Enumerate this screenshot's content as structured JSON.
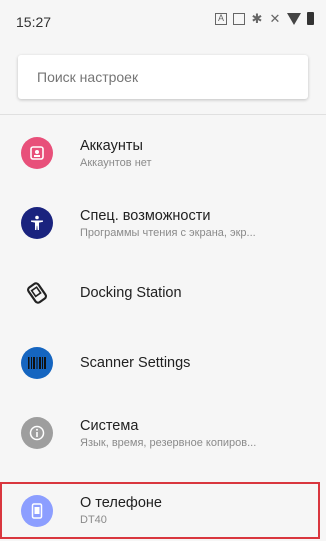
{
  "status_bar": {
    "time": "15:27",
    "icons": [
      "accessibility-a-icon",
      "screenshot-icon",
      "bluetooth-icon",
      "mute-icon",
      "wifi-icon",
      "battery-icon"
    ]
  },
  "search": {
    "placeholder": "Поиск настроек"
  },
  "colors": {
    "accounts": "#e8507a",
    "accessibility": "#1a237e",
    "scanner": "#1565c0",
    "system": "#9e9e9e",
    "about": "#8c9eff",
    "highlight": "#d9363e"
  },
  "settings": {
    "items": [
      {
        "icon": "account-icon",
        "title": "Аккаунты",
        "subtitle": "Аккаунтов нет"
      },
      {
        "icon": "accessibility-icon",
        "title": "Спец. возможности",
        "subtitle": "Программы чтения с экрана, экр..."
      },
      {
        "icon": "docking-station-icon",
        "title": "Docking Station",
        "subtitle": ""
      },
      {
        "icon": "barcode-scanner-icon",
        "title": "Scanner Settings",
        "subtitle": ""
      },
      {
        "icon": "info-icon",
        "title": "Система",
        "subtitle": "Язык, время, резервное копиров..."
      },
      {
        "icon": "phone-icon",
        "title": "О телефоне",
        "subtitle": "DT40"
      }
    ]
  }
}
